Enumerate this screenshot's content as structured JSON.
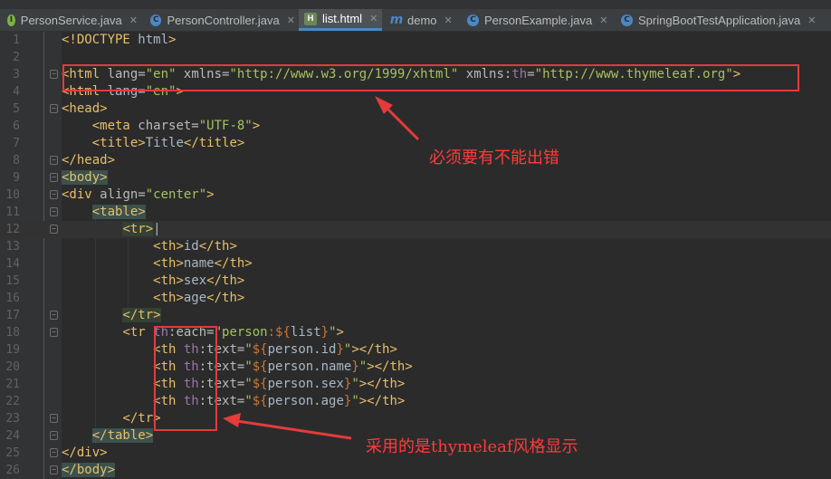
{
  "tabs": [
    {
      "label": "PersonService.java",
      "icon": "interface-icon",
      "icon_color": "#7cb342",
      "active": false
    },
    {
      "label": "PersonController.java",
      "icon": "class-icon",
      "icon_color": "#4a88c7",
      "active": false
    },
    {
      "label": "list.html",
      "icon": "html-file-icon",
      "icon_color": "#6a8759",
      "active": true
    },
    {
      "label": "demo",
      "icon": "m-icon",
      "icon_color": "#4a88c7",
      "active": false
    },
    {
      "label": "PersonExample.java",
      "icon": "class-icon",
      "icon_color": "#4a88c7",
      "active": false
    },
    {
      "label": "SpringBootTestApplication.java",
      "icon": "spring-class-icon",
      "icon_color": "#4a88c7",
      "active": false
    }
  ],
  "editor": {
    "line_numbers": [
      "1",
      "2",
      "3",
      "4",
      "5",
      "6",
      "7",
      "8",
      "9",
      "10",
      "11",
      "12",
      "13",
      "14",
      "15",
      "16",
      "17",
      "18",
      "19",
      "20",
      "21",
      "22",
      "23",
      "24",
      "25",
      "26"
    ],
    "current_line": 12
  },
  "annotations": {
    "note1": "必须要有不能出错",
    "note2": "采用的是thymeleaf风格显示",
    "color": "#e43b3b"
  },
  "colors": {
    "background": "#2b2b2b",
    "tag": "#e8bf6a",
    "attr": "#bababa",
    "string": "#a5c261",
    "text": "#a9b7c6",
    "namespace": "#9876aa"
  }
}
